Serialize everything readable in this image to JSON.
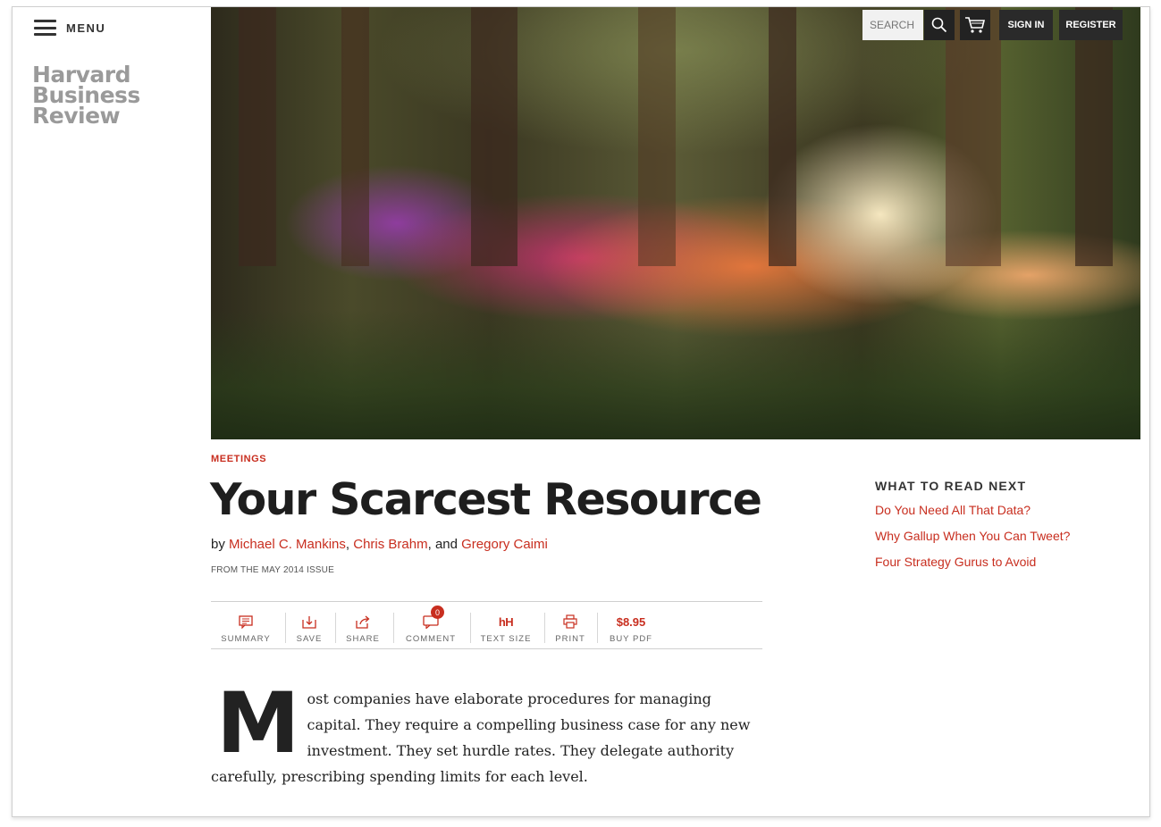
{
  "nav": {
    "menu_label": "MENU"
  },
  "logo": {
    "line1": "Harvard",
    "line2": "Business",
    "line3": "Review"
  },
  "header": {
    "search_placeholder": "SEARCH",
    "sign_in_label": "SIGN IN",
    "register_label": "REGISTER"
  },
  "article": {
    "category": "MEETINGS",
    "title": "Your Scarcest Resource",
    "by_prefix": "by ",
    "authors": [
      "Michael C. Mankins",
      "Chris Brahm",
      "Gregory Caimi"
    ],
    "author_sep1": ", ",
    "author_sep2": ", and ",
    "issue": "FROM THE MAY 2014 ISSUE",
    "dropcap": "M",
    "first_paragraph": "ost companies have elaborate procedures for managing capital. They require a compelling business case for any new investment. They set hurdle rates. They delegate authority carefully, prescribing spending limits for each level."
  },
  "toolbar": {
    "summary_label": "SUMMARY",
    "save_label": "SAVE",
    "share_label": "SHARE",
    "comment_label": "COMMENT",
    "comment_count": "0",
    "text_size_icon": "hH",
    "text_size_label": "TEXT SIZE",
    "print_label": "PRINT",
    "price": "$8.95",
    "buy_pdf_label": "BUY PDF"
  },
  "sidebar": {
    "heading": "WHAT TO READ NEXT",
    "links": [
      "Do You Need All That Data?",
      "Why Gallup When You Can Tweet?",
      "Four Strategy Gurus to Avoid"
    ]
  },
  "colors": {
    "accent": "#c82e1f",
    "logo_gray": "#9a9a9a",
    "button_dark": "#2a2a2a"
  }
}
